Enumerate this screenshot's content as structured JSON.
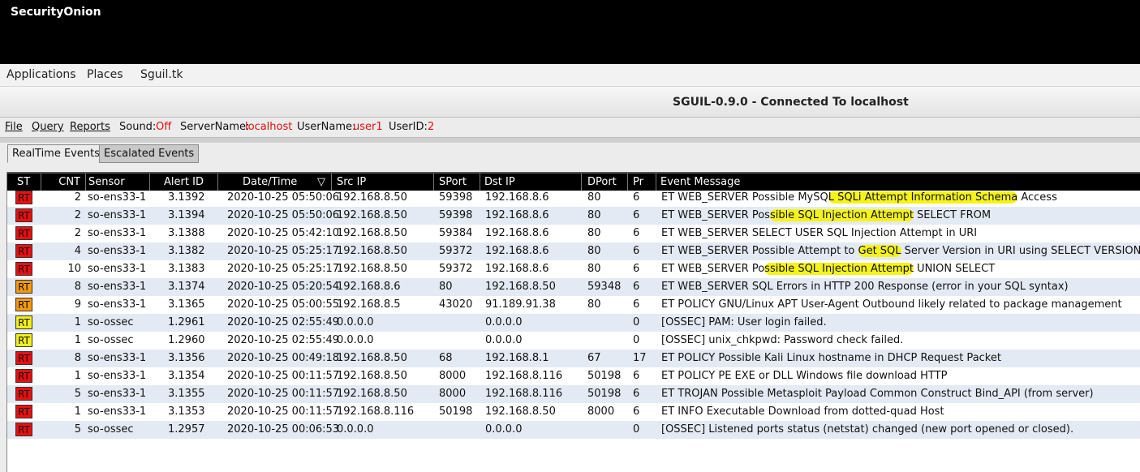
{
  "topbar": {
    "title": "SecurityOnion"
  },
  "menubar": {
    "items": [
      "Applications",
      "Places",
      "Sguil.tk"
    ]
  },
  "window": {
    "title": "SGUIL-0.9.0 - Connected To localhost"
  },
  "appmenu": {
    "file": "File",
    "query": "Query",
    "reports": "Reports",
    "sound_label": "Sound:",
    "sound_value": "Off",
    "server_label": "ServerName:",
    "server_value": "localhost",
    "user_label": "UserName:",
    "user_value": "user1",
    "userid_label": "UserID:",
    "userid_value": "2"
  },
  "tabs": [
    "RealTime Events",
    "Escalated Events"
  ],
  "table": {
    "headers": [
      "ST",
      "CNT",
      "Sensor",
      "Alert ID",
      "Date/Time",
      "Src IP",
      "SPort",
      "Dst IP",
      "DPort",
      "Pr",
      "Event Message"
    ],
    "sort_icon": "▽",
    "status_colors": {
      "red": "#e81010",
      "orange": "#f59a0c",
      "yellow": "#f2ef1c"
    },
    "rows": [
      {
        "st": "RT",
        "color": "red",
        "cnt": "2",
        "sensor": "so-ens33-1",
        "alert_id": "3.1392",
        "datetime": "2020-10-25 05:50:06",
        "src_ip": "192.168.8.50",
        "sport": "59398",
        "dst_ip": "192.168.8.6",
        "dport": "80",
        "pr": "6",
        "msg": "ET WEB_SERVER Possible MySQL SQLi Attempt Information Schema Access"
      },
      {
        "st": "RT",
        "color": "red",
        "cnt": "2",
        "sensor": "so-ens33-1",
        "alert_id": "3.1394",
        "datetime": "2020-10-25 05:50:06",
        "src_ip": "192.168.8.50",
        "sport": "59398",
        "dst_ip": "192.168.8.6",
        "dport": "80",
        "pr": "6",
        "msg": "ET WEB_SERVER Possible SQL Injection Attempt SELECT FROM"
      },
      {
        "st": "RT",
        "color": "red",
        "cnt": "2",
        "sensor": "so-ens33-1",
        "alert_id": "3.1388",
        "datetime": "2020-10-25 05:42:10",
        "src_ip": "192.168.8.50",
        "sport": "59384",
        "dst_ip": "192.168.8.6",
        "dport": "80",
        "pr": "6",
        "msg": "ET WEB_SERVER SELECT USER SQL Injection Attempt in URI"
      },
      {
        "st": "RT",
        "color": "red",
        "cnt": "4",
        "sensor": "so-ens33-1",
        "alert_id": "3.1382",
        "datetime": "2020-10-25 05:25:17",
        "src_ip": "192.168.8.50",
        "sport": "59372",
        "dst_ip": "192.168.8.6",
        "dport": "80",
        "pr": "6",
        "msg": "ET WEB_SERVER Possible Attempt to Get SQL Server Version in URI using SELECT VERSION"
      },
      {
        "st": "RT",
        "color": "red",
        "cnt": "10",
        "sensor": "so-ens33-1",
        "alert_id": "3.1383",
        "datetime": "2020-10-25 05:25:17",
        "src_ip": "192.168.8.50",
        "sport": "59372",
        "dst_ip": "192.168.8.6",
        "dport": "80",
        "pr": "6",
        "msg": "ET WEB_SERVER Possible SQL Injection Attempt UNION SELECT"
      },
      {
        "st": "RT",
        "color": "orange",
        "cnt": "8",
        "sensor": "so-ens33-1",
        "alert_id": "3.1374",
        "datetime": "2020-10-25 05:20:54",
        "src_ip": "192.168.8.6",
        "sport": "80",
        "dst_ip": "192.168.8.50",
        "dport": "59348",
        "pr": "6",
        "msg": "ET WEB_SERVER SQL Errors in HTTP 200 Response (error in your SQL syntax)"
      },
      {
        "st": "RT",
        "color": "orange",
        "cnt": "9",
        "sensor": "so-ens33-1",
        "alert_id": "3.1365",
        "datetime": "2020-10-25 05:00:55",
        "src_ip": "192.168.8.5",
        "sport": "43020",
        "dst_ip": "91.189.91.38",
        "dport": "80",
        "pr": "6",
        "msg": "ET POLICY GNU/Linux APT User-Agent Outbound likely related to package management"
      },
      {
        "st": "RT",
        "color": "yellow",
        "cnt": "1",
        "sensor": "so-ossec",
        "alert_id": "1.2961",
        "datetime": "2020-10-25 02:55:49",
        "src_ip": "0.0.0.0",
        "sport": "",
        "dst_ip": "0.0.0.0",
        "dport": "",
        "pr": "0",
        "msg": "[OSSEC] PAM: User login failed."
      },
      {
        "st": "RT",
        "color": "yellow",
        "cnt": "1",
        "sensor": "so-ossec",
        "alert_id": "1.2960",
        "datetime": "2020-10-25 02:55:49",
        "src_ip": "0.0.0.0",
        "sport": "",
        "dst_ip": "0.0.0.0",
        "dport": "",
        "pr": "0",
        "msg": "[OSSEC] unix_chkpwd: Password check failed."
      },
      {
        "st": "RT",
        "color": "red",
        "cnt": "8",
        "sensor": "so-ens33-1",
        "alert_id": "3.1356",
        "datetime": "2020-10-25 00:49:18",
        "src_ip": "192.168.8.50",
        "sport": "68",
        "dst_ip": "192.168.8.1",
        "dport": "67",
        "pr": "17",
        "msg": "ET POLICY Possible Kali Linux hostname in DHCP Request Packet"
      },
      {
        "st": "RT",
        "color": "red",
        "cnt": "1",
        "sensor": "so-ens33-1",
        "alert_id": "3.1354",
        "datetime": "2020-10-25 00:11:57",
        "src_ip": "192.168.8.50",
        "sport": "8000",
        "dst_ip": "192.168.8.116",
        "dport": "50198",
        "pr": "6",
        "msg": "ET POLICY PE EXE or DLL Windows file download HTTP"
      },
      {
        "st": "RT",
        "color": "red",
        "cnt": "5",
        "sensor": "so-ens33-1",
        "alert_id": "3.1355",
        "datetime": "2020-10-25 00:11:57",
        "src_ip": "192.168.8.50",
        "sport": "8000",
        "dst_ip": "192.168.8.116",
        "dport": "50198",
        "pr": "6",
        "msg": "ET TROJAN Possible Metasploit Payload Common Construct Bind_API (from server)"
      },
      {
        "st": "RT",
        "color": "red",
        "cnt": "1",
        "sensor": "so-ens33-1",
        "alert_id": "3.1353",
        "datetime": "2020-10-25 00:11:57",
        "src_ip": "192.168.8.116",
        "sport": "50198",
        "dst_ip": "192.168.8.50",
        "dport": "8000",
        "pr": "6",
        "msg": "ET INFO Executable Download from dotted-quad Host"
      },
      {
        "st": "RT",
        "color": "red",
        "cnt": "5",
        "sensor": "so-ossec",
        "alert_id": "1.2957",
        "datetime": "2020-10-25 00:06:53",
        "src_ip": "0.0.0.0",
        "sport": "",
        "dst_ip": "0.0.0.0",
        "dport": "",
        "pr": "0",
        "msg": "[OSSEC] Listened ports status (netstat) changed (new port opened or closed)."
      }
    ]
  }
}
